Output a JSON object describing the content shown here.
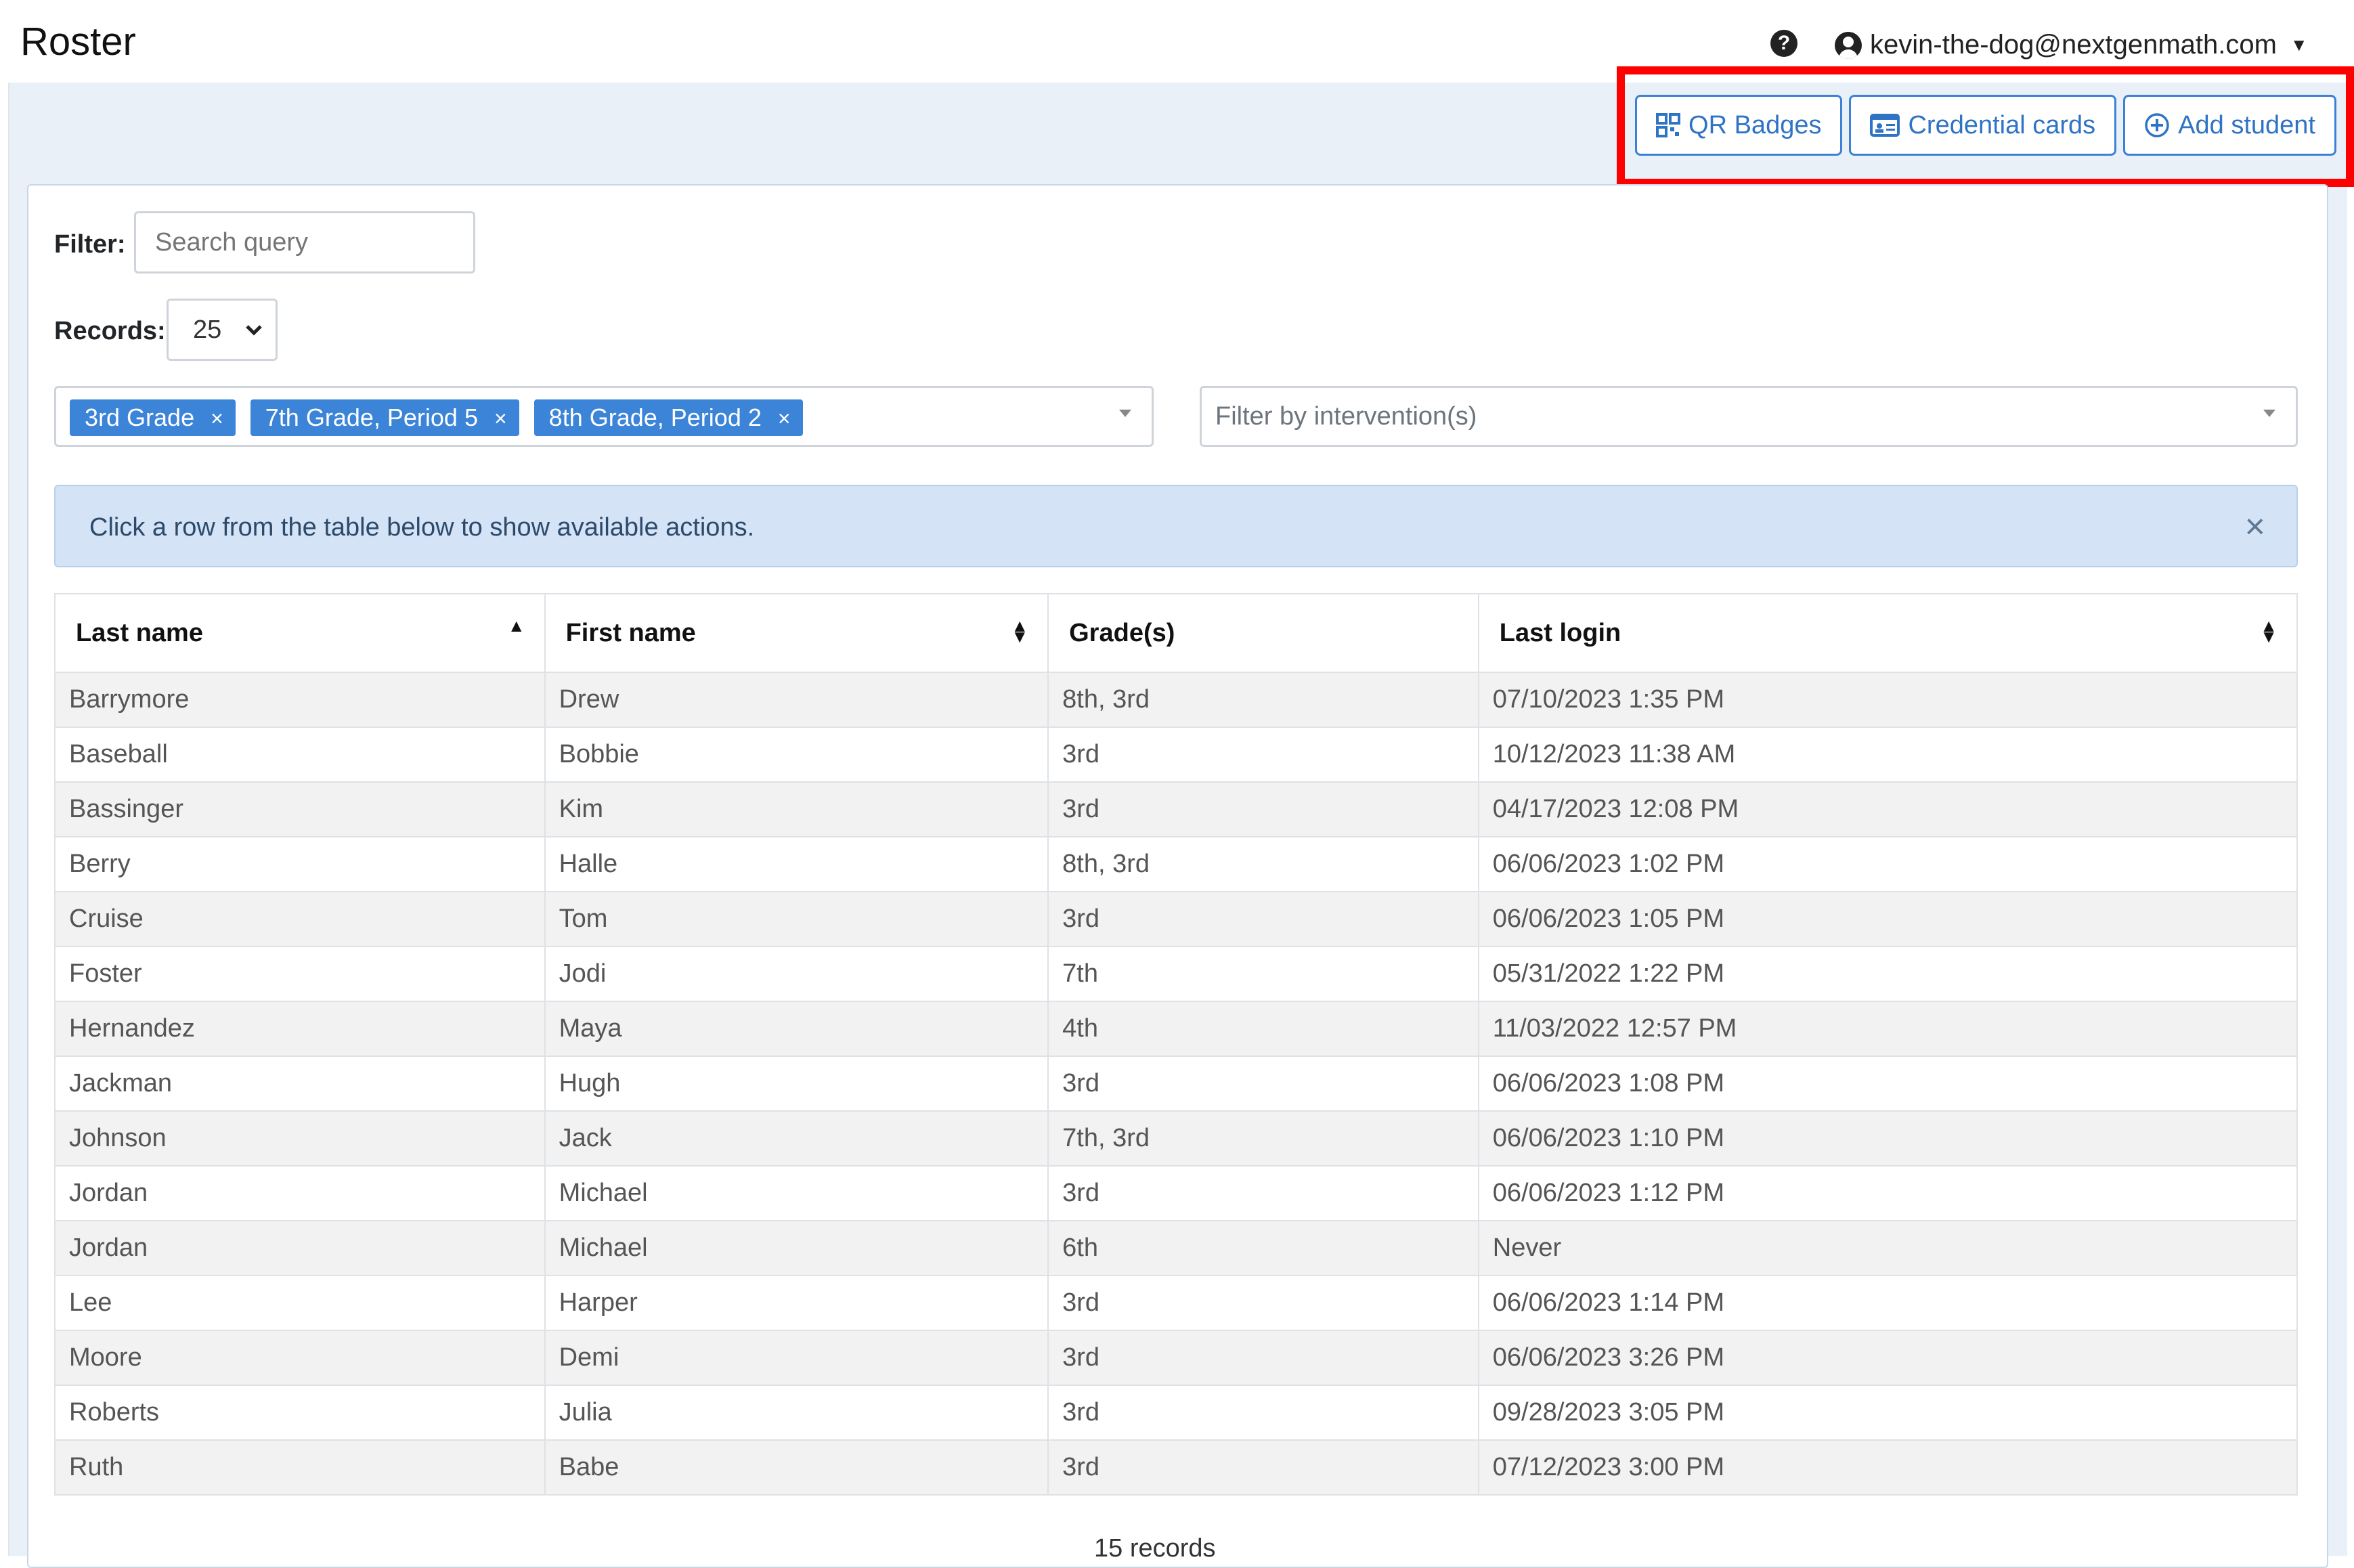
{
  "header": {
    "title": "Roster",
    "help_glyph": "?",
    "user_email": "kevin-the-dog@nextgenmath.com"
  },
  "actions": {
    "qr_badges": "QR Badges",
    "credential_cards": "Credential cards",
    "add_student": "Add student",
    "accent_color": "#3b82d6",
    "highlight_color": "#ff0000"
  },
  "filter": {
    "label": "Filter:",
    "placeholder": "Search query"
  },
  "records": {
    "label": "Records:",
    "value": "25"
  },
  "grade_filter": {
    "tags": [
      "3rd Grade",
      "7th Grade, Period 5",
      "8th Grade, Period 2"
    ],
    "remove_glyph": "×"
  },
  "intervention_filter": {
    "placeholder": "Filter by intervention(s)"
  },
  "alert": {
    "message": "Click a row from the table below to show available actions.",
    "close_glyph": "×"
  },
  "table": {
    "headers": [
      "Last name",
      "First name",
      "Grade(s)",
      "Last login"
    ],
    "rows": [
      [
        "Barrymore",
        "Drew",
        "8th, 3rd",
        "07/10/2023 1:35 PM"
      ],
      [
        "Baseball",
        "Bobbie",
        "3rd",
        "10/12/2023 11:38 AM"
      ],
      [
        "Bassinger",
        "Kim",
        "3rd",
        "04/17/2023 12:08 PM"
      ],
      [
        "Berry",
        "Halle",
        "8th, 3rd",
        "06/06/2023 1:02 PM"
      ],
      [
        "Cruise",
        "Tom",
        "3rd",
        "06/06/2023 1:05 PM"
      ],
      [
        "Foster",
        "Jodi",
        "7th",
        "05/31/2022 1:22 PM"
      ],
      [
        "Hernandez",
        "Maya",
        "4th",
        "11/03/2022 12:57 PM"
      ],
      [
        "Jackman",
        "Hugh",
        "3rd",
        "06/06/2023 1:08 PM"
      ],
      [
        "Johnson",
        "Jack",
        "7th, 3rd",
        "06/06/2023 1:10 PM"
      ],
      [
        "Jordan",
        "Michael",
        "3rd",
        "06/06/2023 1:12 PM"
      ],
      [
        "Jordan",
        "Michael",
        "6th",
        "Never"
      ],
      [
        "Lee",
        "Harper",
        "3rd",
        "06/06/2023 1:14 PM"
      ],
      [
        "Moore",
        "Demi",
        "3rd",
        "06/06/2023 3:26 PM"
      ],
      [
        "Roberts",
        "Julia",
        "3rd",
        "09/28/2023 3:05 PM"
      ],
      [
        "Ruth",
        "Babe",
        "3rd",
        "07/12/2023 3:00 PM"
      ]
    ]
  },
  "footer": {
    "record_count": "15 records"
  }
}
